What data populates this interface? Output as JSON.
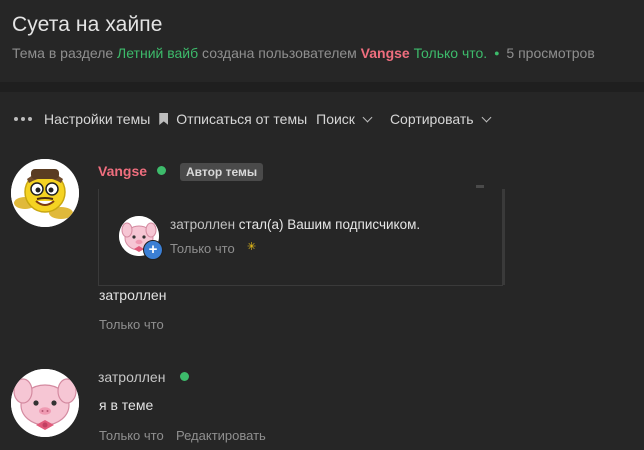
{
  "thread": {
    "title": "Суета на хайпе",
    "meta_prefix": "Тема в разделе",
    "section": "Летний вайб",
    "meta_mid": "создана пользователем",
    "author": "Vangse",
    "created": "Только что.",
    "views": "5 просмотров"
  },
  "toolbar": {
    "settings": "Настройки темы",
    "unsubscribe": "Отписаться от темы",
    "search": "Поиск",
    "sort": "Сортировать"
  },
  "posts": [
    {
      "username": "Vangse",
      "badge": "Автор темы",
      "embed": {
        "notif_user": "затроллен",
        "notif_action": "стал(а) Вашим подписчиком.",
        "notif_time": "Только что",
        "notif_plus": "+",
        "notif_star": "✳"
      },
      "text": "затроллен",
      "time": "Только что"
    },
    {
      "username": "затроллен",
      "text": "я в теме",
      "time": "Только что",
      "edit": "Редактировать"
    }
  ],
  "colors": {
    "background": "#262626",
    "accent_green": "#3dbb6b",
    "author_pink": "#ef6e7e",
    "plus_blue": "#3b7fd4"
  },
  "icons": [
    "more-dots-icon",
    "bookmark-icon",
    "chevron-down-icon",
    "online-indicator-icon",
    "plus-icon",
    "star-icon"
  ]
}
